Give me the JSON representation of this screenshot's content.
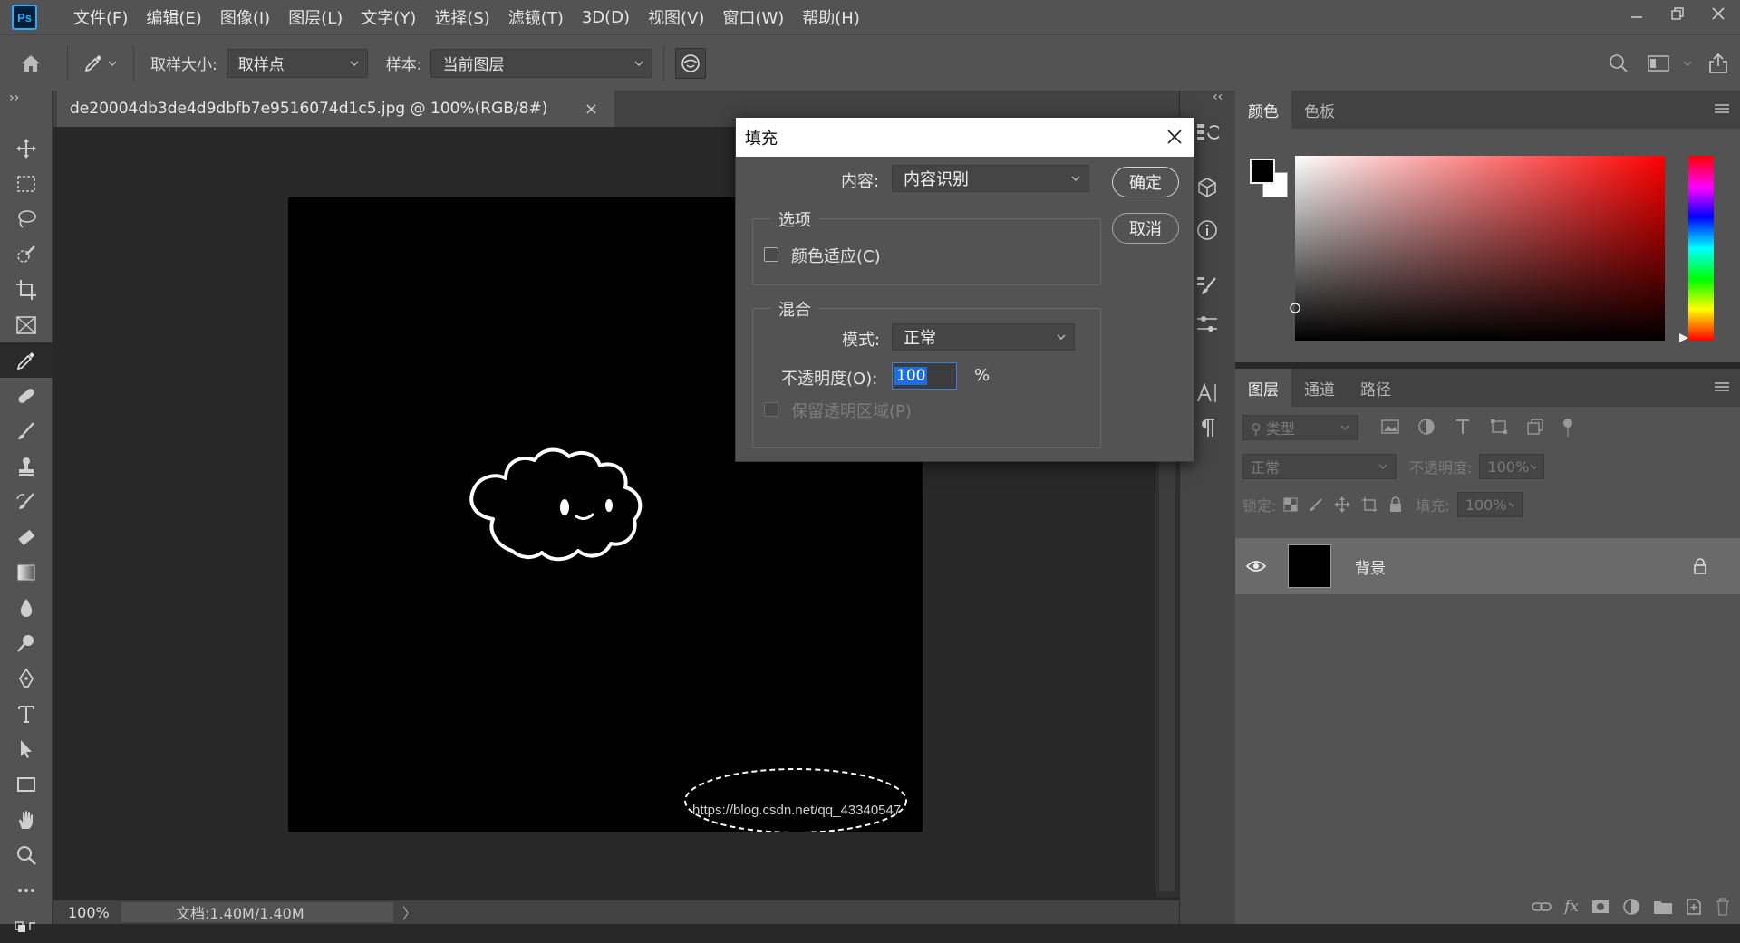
{
  "app": {
    "logo": "Ps"
  },
  "menu": [
    "文件(F)",
    "编辑(E)",
    "图像(I)",
    "图层(L)",
    "文字(Y)",
    "选择(S)",
    "滤镜(T)",
    "3D(D)",
    "视图(V)",
    "窗口(W)",
    "帮助(H)"
  ],
  "options": {
    "sample_size_label": "取样大小:",
    "sample_size_value": "取样点",
    "sample_label": "样本:",
    "sample_value": "当前图层"
  },
  "document": {
    "tab_title": "de20004db3de4d9dbfb7e9516074d1c5.jpg @ 100%(RGB/8#)",
    "close": "×",
    "watermark": "https://blog.csdn.net/qq_43340547"
  },
  "status": {
    "zoom": "100%",
    "doc_info": "文档:1.40M/1.40M",
    "arrow": "〉"
  },
  "panels": {
    "collapse_left": "››",
    "collapse_right": "‹‹",
    "color_tabs": [
      "颜色",
      "色板"
    ],
    "layer_tabs": [
      "图层",
      "通道",
      "路径"
    ],
    "filter_placeholder": "类型",
    "blend_mode": "正常",
    "opacity_label": "不透明度:",
    "opacity_value": "100%",
    "lock_label": "锁定:",
    "fill_label": "填充:",
    "fill_value": "100%",
    "layer_name": "背景",
    "fx": "fx"
  },
  "dialog": {
    "title": "填充",
    "content_label": "内容:",
    "content_value": "内容识别",
    "options_group": "选项",
    "color_adapt": "颜色适应(C)",
    "blend_group": "混合",
    "mode_label": "模式:",
    "mode_value": "正常",
    "opacity_label": "不透明度(O):",
    "opacity_value": "100",
    "percent": "%",
    "preserve": "保留透明区域(P)",
    "ok": "确定",
    "cancel": "取消"
  },
  "colors": {
    "accent": "#1b6fe0",
    "ui_bg": "#535353",
    "canvas_bg": "#282828"
  }
}
